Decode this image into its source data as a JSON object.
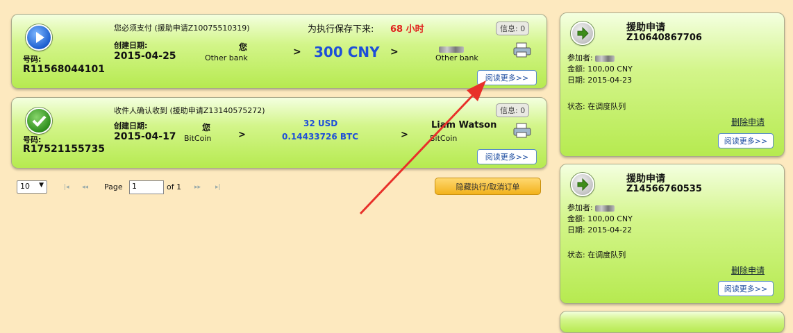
{
  "orders": [
    {
      "status": "您必须支付 (援助申请Z10075510319)",
      "deadline_label": "为执行保存下来:",
      "deadline_value": "68 小时",
      "info": "信息: 0",
      "number_label": "号码:",
      "number": "R11568044101",
      "created_label": "创建日期:",
      "created_date": "2015-04-25",
      "from_name": "您",
      "from_method": "Other bank",
      "gt": ">",
      "amount": "300 CNY",
      "to_method": "Other bank",
      "read_more": "阅读更多>>"
    },
    {
      "status": "收件人确认收到 (援助申请Z13140575272)",
      "info": "信息: 0",
      "number_label": "号码:",
      "number": "R17521155735",
      "created_label": "创建日期:",
      "created_date": "2015-04-17",
      "from_name": "您",
      "from_method": "BitCoin",
      "gt": ">",
      "amount_usd": "32 USD",
      "amount_btc": "0.14433726 BTC",
      "to_name": "Liam Watson",
      "to_method": "BitCoin",
      "read_more": "阅读更多>>"
    }
  ],
  "pager": {
    "per_page": "10",
    "first": "|◂",
    "prev": "◂◂",
    "page_label": "Page",
    "page_value": "1",
    "of_label": "of 1",
    "next": "▸▸",
    "last": "▸|",
    "hide_button": "隐藏执行/取消订单"
  },
  "requests": [
    {
      "title": "援助申请",
      "id": "Z10640867706",
      "participant_label": "参加者:",
      "amount": "金额: 100,00 CNY",
      "date": "日期: 2015-04-23",
      "status": "状态: 在调度队列",
      "delete": "删除申请",
      "read_more": "阅读更多>>"
    },
    {
      "title": "援助申请",
      "id": "Z14566760535",
      "participant_label": "参加者:",
      "amount": "金额: 100,00 CNY",
      "date": "日期: 2015-04-22",
      "status": "状态: 在调度队列",
      "delete": "删除申请",
      "read_more": "阅读更多>>"
    }
  ],
  "colors": {
    "page_bg": "#fde9bf",
    "card_green": "#b6ea50",
    "deadline_red": "#e0201c",
    "amount_blue": "#1e4fd8",
    "annotation_arrow": "#e8302a"
  }
}
